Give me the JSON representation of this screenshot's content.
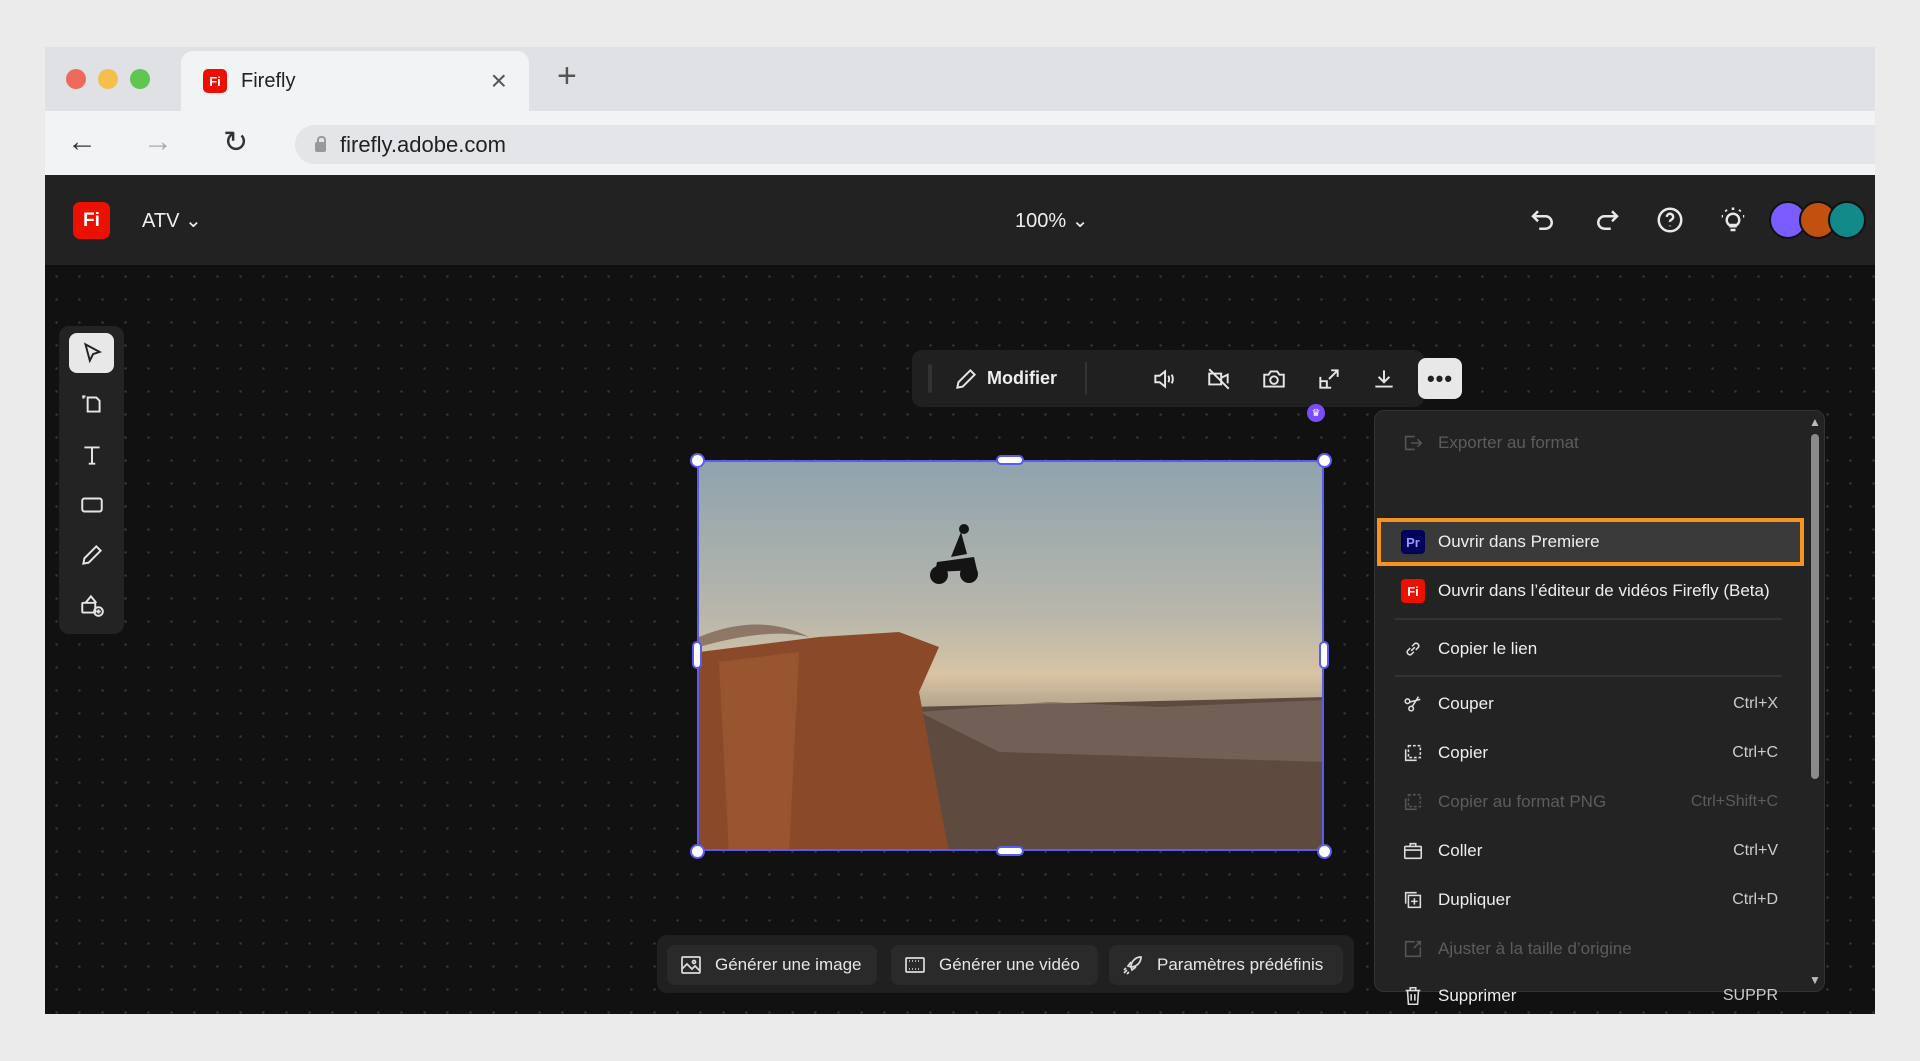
{
  "browser": {
    "tab_title": "Firefly",
    "tab_favicon": "Fi",
    "url": "firefly.adobe.com"
  },
  "app": {
    "logo": "Fi",
    "project_name": "ATV",
    "zoom": "100%",
    "avatars": [
      "#7b5cff",
      "#c2500e",
      "#138a8a"
    ]
  },
  "toolbar": {
    "modifier_label": "Modifier",
    "more_label": "•••"
  },
  "menu": {
    "items": [
      {
        "label": "Exporter au format",
        "shortcut": "",
        "disabled": true
      },
      {
        "label": "Ouvrir dans Premiere",
        "shortcut": "",
        "badge": "Pr",
        "highlighted": true
      },
      {
        "label": "Ouvrir dans l’éditeur de vidéos Firefly (Beta)",
        "shortcut": "",
        "badge": "Fi"
      },
      {
        "label": "Copier le lien",
        "shortcut": ""
      },
      {
        "label": "Couper",
        "shortcut": "Ctrl+X"
      },
      {
        "label": "Copier",
        "shortcut": "Ctrl+C"
      },
      {
        "label": "Copier au format PNG",
        "shortcut": "Ctrl+Shift+C",
        "disabled": true
      },
      {
        "label": "Coller",
        "shortcut": "Ctrl+V"
      },
      {
        "label": "Dupliquer",
        "shortcut": "Ctrl+D"
      },
      {
        "label": "Ajuster à la taille d’origine",
        "shortcut": "",
        "disabled": true
      },
      {
        "label": "Supprimer",
        "shortcut": "SUPPR"
      }
    ]
  },
  "bottom_bar": {
    "generate_image": "Générer une image",
    "generate_video": "Générer une vidéo",
    "presets": "Paramètres prédéfinis"
  },
  "colors": {
    "highlight": "#f7941d",
    "selection": "#5b5bf0",
    "firefly_red": "#eb1000",
    "premiere_blue": "#00005b"
  }
}
